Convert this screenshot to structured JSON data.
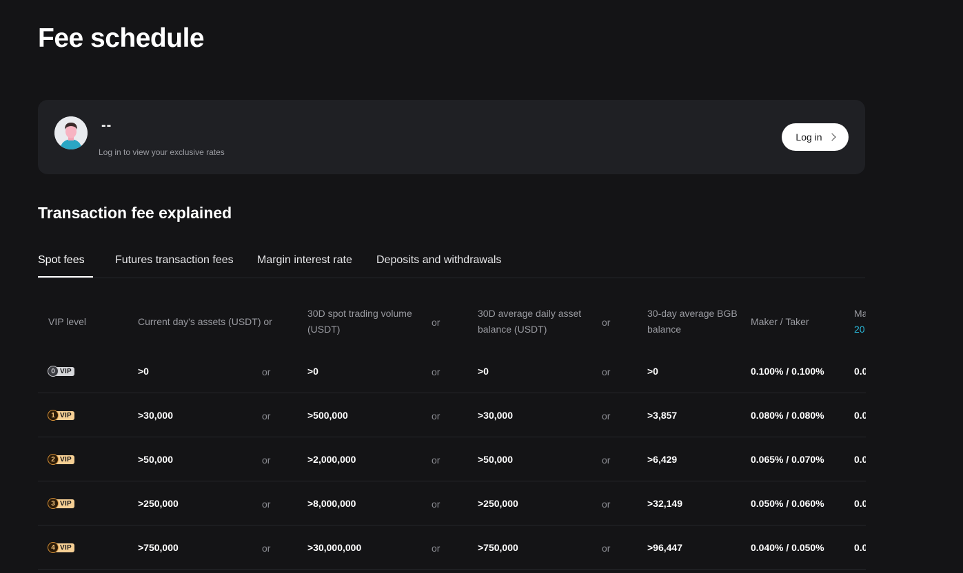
{
  "page": {
    "title": "Fee schedule"
  },
  "account": {
    "name": "--",
    "subtitle": "Log in to view your exclusive rates",
    "login_label": "Log in"
  },
  "section": {
    "title": "Transaction fee explained"
  },
  "tabs": [
    {
      "label": "Spot fees",
      "active": true
    },
    {
      "label": "Futures transaction fees",
      "active": false
    },
    {
      "label": "Margin interest rate",
      "active": false
    },
    {
      "label": "Deposits and withdrawals",
      "active": false
    }
  ],
  "table": {
    "headers": {
      "vip": "VIP level",
      "assets": "Current day's assets (USDT) or",
      "volume_1": "30D spot trading volume",
      "volume_2": "(USDT)",
      "balance_1": "30D average daily asset",
      "balance_2": "balance (USDT)",
      "bgb_1": "30-day average BGB",
      "bgb_2": "balance",
      "maker_taker": "Maker / Taker",
      "clipped_1": "Ma",
      "clipped_2": "20"
    },
    "or_label": "or",
    "vip_tag": "VIP",
    "rows": [
      {
        "level": "0",
        "assets": ">0",
        "volume": ">0",
        "balance": ">0",
        "bgb": ">0",
        "fee": "0.100% / 0.100%",
        "clipped": "0.0"
      },
      {
        "level": "1",
        "assets": ">30,000",
        "volume": ">500,000",
        "balance": ">30,000",
        "bgb": ">3,857",
        "fee": "0.080% / 0.080%",
        "clipped": "0.0"
      },
      {
        "level": "2",
        "assets": ">50,000",
        "volume": ">2,000,000",
        "balance": ">50,000",
        "bgb": ">6,429",
        "fee": "0.065% / 0.070%",
        "clipped": "0.0"
      },
      {
        "level": "3",
        "assets": ">250,000",
        "volume": ">8,000,000",
        "balance": ">250,000",
        "bgb": ">32,149",
        "fee": "0.050% / 0.060%",
        "clipped": "0.0"
      },
      {
        "level": "4",
        "assets": ">750,000",
        "volume": ">30,000,000",
        "balance": ">750,000",
        "bgb": ">96,447",
        "fee": "0.040% / 0.050%",
        "clipped": "0.0"
      }
    ]
  }
}
